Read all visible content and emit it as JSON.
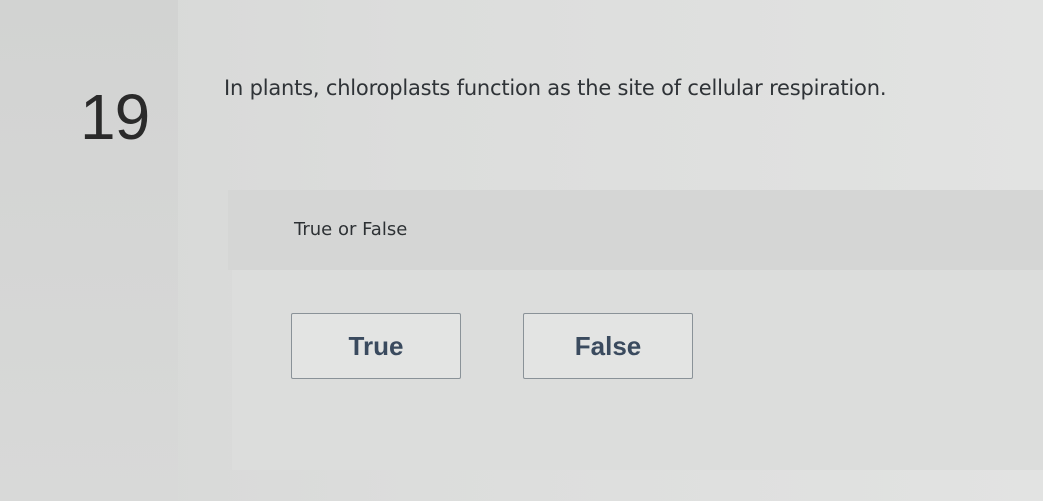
{
  "question": {
    "number": "19",
    "text": "In plants, chloroplasts function as the site of cellular respiration."
  },
  "prompt": {
    "label": "True or False"
  },
  "answers": {
    "true_label": "True",
    "false_label": "False"
  }
}
